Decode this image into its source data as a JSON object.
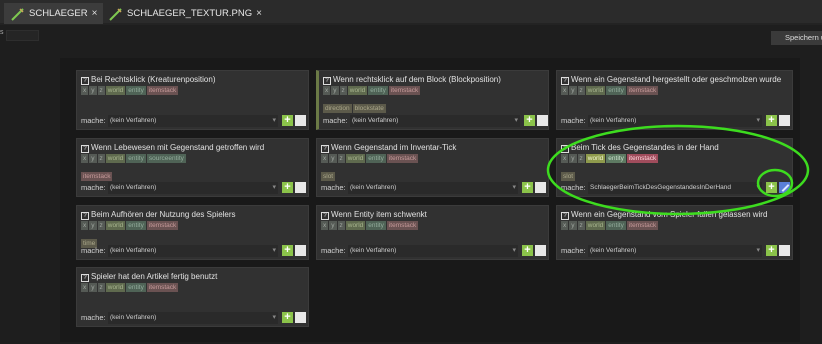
{
  "tabs": [
    {
      "label": "SCHLAEGER",
      "close": "×",
      "active": true
    },
    {
      "label": "SCHLAEGER_TEXTUR.PNG",
      "close": "×",
      "active": false
    }
  ],
  "toolbar": {
    "small_field_label": "s",
    "save_label": "Speichern u"
  },
  "tag_labels": {
    "x": "x",
    "y": "y",
    "z": "z",
    "world": "world",
    "entity": "entity",
    "itemstack": "itemstack",
    "direction": "direction",
    "blockstate": "blockstate",
    "sourceentity": "sourceentity",
    "slot": "slot",
    "time": "time"
  },
  "qmark": "?",
  "mache_label": "mache:",
  "default_proc": "(kein Verfahren)",
  "add_symbol": "+",
  "caret": "▾",
  "cards": [
    {
      "title": "Bei Rechtsklick (Kreaturenposition)",
      "proc": "(kein Verfahren)"
    },
    {
      "title": "Wenn rechtsklick auf dem Block (Blockposition)",
      "proc": "(kein Verfahren)"
    },
    {
      "title": "Wenn ein Gegenstand hergestellt oder geschmolzen wurde",
      "proc": "(kein Verfahren)"
    },
    {
      "title": "Wenn Lebewesen mit Gegenstand getroffen wird",
      "proc": "(kein Verfahren)"
    },
    {
      "title": "Wenn Gegenstand im Inventar-Tick",
      "proc": "(kein Verfahren)"
    },
    {
      "title": "Beim Tick des Gegenstandes in der Hand",
      "proc": "SchlaegerBeimTickDesGegenstandesInDerHand"
    },
    {
      "title": "Beim Aufhören der Nutzung des Spielers",
      "proc": "(kein Verfahren)"
    },
    {
      "title": "Wenn Entity item schwenkt",
      "proc": "(kein Verfahren)"
    },
    {
      "title": "Wenn ein Gegenstand vom Spieler fallen gelassen wird",
      "proc": "(kein Verfahren)"
    },
    {
      "title": "Spieler hat den Artikel fertig benutzt",
      "proc": "(kein Verfahren)"
    }
  ],
  "colors": {
    "accent_green": "#8bc34a",
    "annotation_green": "#3ddc1f",
    "edit_blue": "#5a7fd6"
  }
}
